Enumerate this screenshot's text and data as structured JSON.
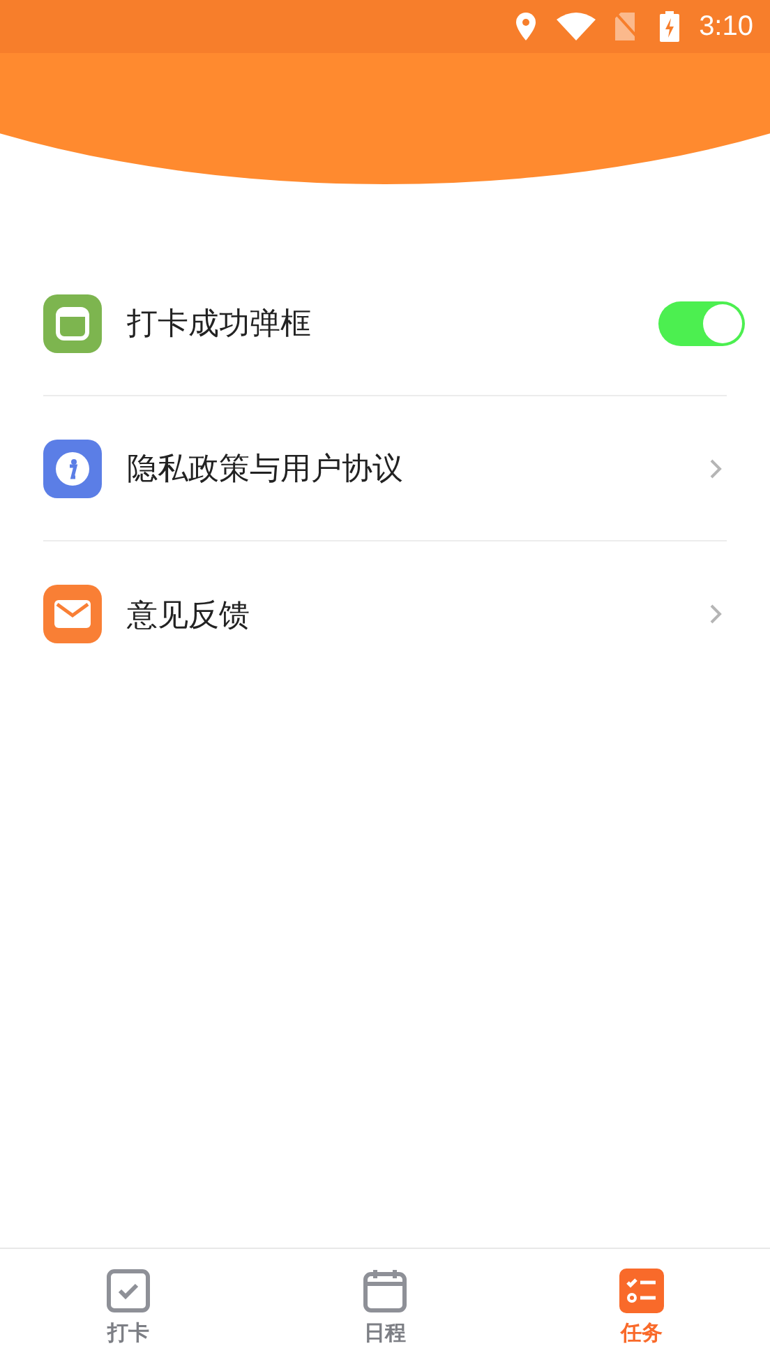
{
  "status_bar": {
    "time": "3:10"
  },
  "settings": [
    {
      "kind": "toggle",
      "label": "打卡成功弹框",
      "on": true
    },
    {
      "kind": "link",
      "label": "隐私政策与用户协议"
    },
    {
      "kind": "link",
      "label": "意见反馈"
    }
  ],
  "tabs": [
    {
      "label": "打卡",
      "selected": false
    },
    {
      "label": "日程",
      "selected": false
    },
    {
      "label": "任务",
      "selected": true
    }
  ]
}
